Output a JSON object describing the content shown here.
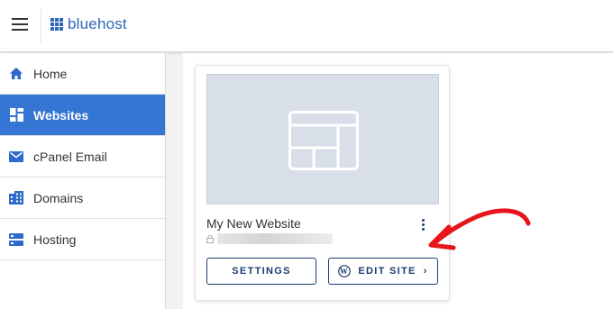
{
  "header": {
    "menu_icon": "hamburger-icon",
    "logo_text": "bluehost",
    "logo_icon": "bluehost-grid-icon",
    "brand_color": "#2e66ba"
  },
  "sidebar": {
    "items": [
      {
        "label": "Home",
        "icon": "home-icon",
        "active": false
      },
      {
        "label": "Websites",
        "icon": "websites-icon",
        "active": true
      },
      {
        "label": "cPanel Email",
        "icon": "mail-icon",
        "active": false
      },
      {
        "label": "Domains",
        "icon": "domains-icon",
        "active": false
      },
      {
        "label": "Hosting",
        "icon": "hosting-icon",
        "active": false
      }
    ],
    "active_color": "#3575d3"
  },
  "site_card": {
    "name": "My New Website",
    "thumbnail_icon": "website-layout-icon",
    "settings_label": "SETTINGS",
    "edit_label": "EDIT SITE",
    "edit_icon": "wordpress-icon",
    "more_icon": "kebab-menu-icon"
  },
  "annotation": {
    "color": "#e8141b",
    "icon": "red-arrow-annotation"
  }
}
